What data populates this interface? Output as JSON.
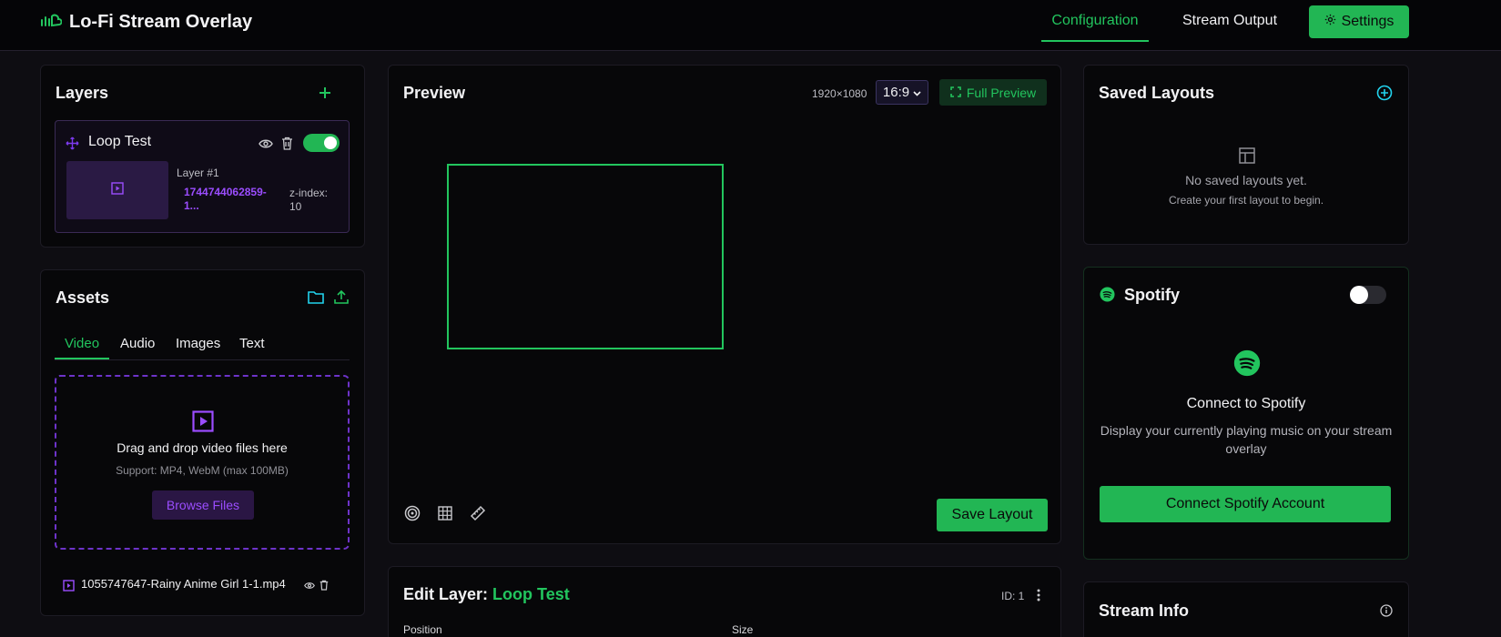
{
  "app": {
    "title": "Lo-Fi Stream Overlay"
  },
  "nav": {
    "configuration": "Configuration",
    "stream_output": "Stream Output",
    "settings": "Settings"
  },
  "layers": {
    "title": "Layers",
    "item": {
      "name": "Loop Test",
      "enabled": true,
      "number": "Layer #1",
      "source": "1744744062859-1...",
      "z_index_label": "z-index:",
      "z_index": "10"
    }
  },
  "assets": {
    "title": "Assets",
    "tabs": [
      "Video",
      "Audio",
      "Images",
      "Text"
    ],
    "active_tab": "Video",
    "dropzone": {
      "heading": "Drag and drop video files here",
      "support": "Support: MP4, WebM (max 100MB)",
      "browse": "Browse Files"
    },
    "files": [
      {
        "name": "1055747647-Rainy Anime Girl 1-1.mp4"
      }
    ]
  },
  "preview": {
    "title": "Preview",
    "resolution": "1920×1080",
    "aspect": "16:9",
    "full_preview": "Full Preview",
    "save_layout": "Save Layout"
  },
  "edit_layer": {
    "title_prefix": "Edit Layer:",
    "layer_name": "Loop Test",
    "id_label": "ID: 1",
    "position_label": "Position",
    "size_label": "Size"
  },
  "saved_layouts": {
    "title": "Saved Layouts",
    "empty": "No saved layouts yet.",
    "hint": "Create your first layout to begin."
  },
  "spotify": {
    "title": "Spotify",
    "enabled": false,
    "heading": "Connect to Spotify",
    "description": "Display your currently playing music on your stream overlay",
    "connect": "Connect Spotify Account"
  },
  "stream_info": {
    "title": "Stream Info"
  },
  "colors": {
    "accent_green": "#22c55e",
    "accent_purple": "#9b4dff",
    "accent_cyan": "#22d3ee",
    "background": "#0e0d12",
    "card": "#070709"
  }
}
